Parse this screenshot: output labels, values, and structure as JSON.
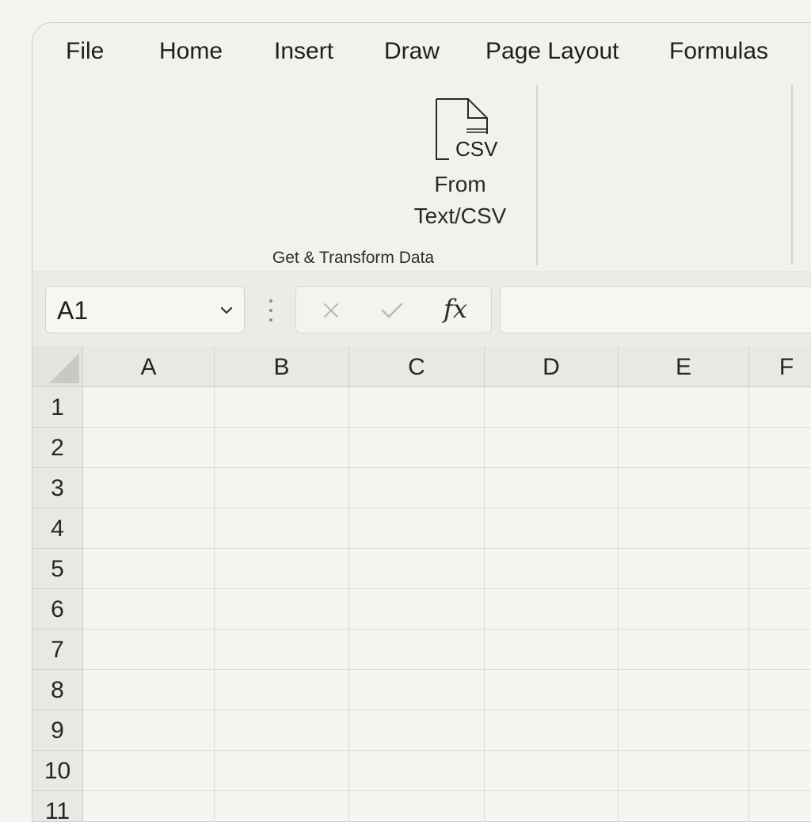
{
  "ribbon": {
    "tabs": [
      {
        "label": "File"
      },
      {
        "label": "Home"
      },
      {
        "label": "Insert"
      },
      {
        "label": "Draw"
      },
      {
        "label": "Page Layout"
      },
      {
        "label": "Formulas"
      }
    ],
    "from_text_csv": {
      "icon": "csv-file-icon",
      "icon_text": "CSV",
      "label_line1": "From",
      "label_line2": "Text/CSV"
    },
    "group_label": "Get & Transform Data"
  },
  "formula_bar": {
    "name_box_value": "A1",
    "cancel_icon": "close-icon",
    "enter_icon": "checkmark-icon",
    "insert_function_label": "fx",
    "formula_value": ""
  },
  "grid": {
    "columns": [
      "A",
      "B",
      "C",
      "D",
      "E",
      "F"
    ],
    "rows": [
      "1",
      "2",
      "3",
      "4",
      "5",
      "6",
      "7",
      "8",
      "9",
      "10",
      "11"
    ],
    "cells": []
  }
}
